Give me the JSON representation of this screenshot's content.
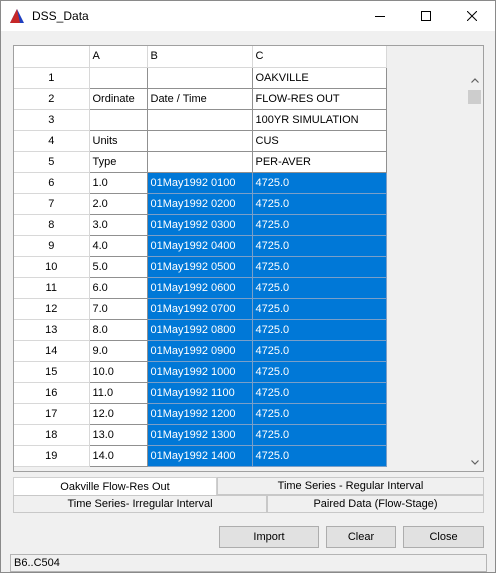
{
  "window": {
    "title": "DSS_Data"
  },
  "grid": {
    "columns": [
      "",
      "A",
      "B",
      "C"
    ],
    "rows": [
      {
        "num": "1",
        "a": "",
        "b": "",
        "c": "OAKVILLE",
        "sel": false
      },
      {
        "num": "2",
        "a": "Ordinate",
        "b": "Date / Time",
        "c": "FLOW-RES OUT",
        "sel": false
      },
      {
        "num": "3",
        "a": "",
        "b": "",
        "c": "100YR SIMULATION",
        "sel": false
      },
      {
        "num": "4",
        "a": "Units",
        "b": "",
        "c": "CUS",
        "sel": false
      },
      {
        "num": "5",
        "a": "Type",
        "b": "",
        "c": "PER-AVER",
        "sel": false
      },
      {
        "num": "6",
        "a": "1.0",
        "b": "01May1992 0100",
        "c": "4725.0",
        "sel": true
      },
      {
        "num": "7",
        "a": "2.0",
        "b": "01May1992 0200",
        "c": "4725.0",
        "sel": true
      },
      {
        "num": "8",
        "a": "3.0",
        "b": "01May1992 0300",
        "c": "4725.0",
        "sel": true
      },
      {
        "num": "9",
        "a": "4.0",
        "b": "01May1992 0400",
        "c": "4725.0",
        "sel": true
      },
      {
        "num": "10",
        "a": "5.0",
        "b": "01May1992 0500",
        "c": "4725.0",
        "sel": true
      },
      {
        "num": "11",
        "a": "6.0",
        "b": "01May1992 0600",
        "c": "4725.0",
        "sel": true
      },
      {
        "num": "12",
        "a": "7.0",
        "b": "01May1992 0700",
        "c": "4725.0",
        "sel": true
      },
      {
        "num": "13",
        "a": "8.0",
        "b": "01May1992 0800",
        "c": "4725.0",
        "sel": true
      },
      {
        "num": "14",
        "a": "9.0",
        "b": "01May1992 0900",
        "c": "4725.0",
        "sel": true
      },
      {
        "num": "15",
        "a": "10.0",
        "b": "01May1992 1000",
        "c": "4725.0",
        "sel": true
      },
      {
        "num": "16",
        "a": "11.0",
        "b": "01May1992 1100",
        "c": "4725.0",
        "sel": true
      },
      {
        "num": "17",
        "a": "12.0",
        "b": "01May1992 1200",
        "c": "4725.0",
        "sel": true
      },
      {
        "num": "18",
        "a": "13.0",
        "b": "01May1992 1300",
        "c": "4725.0",
        "sel": true
      },
      {
        "num": "19",
        "a": "14.0",
        "b": "01May1992 1400",
        "c": "4725.0",
        "sel": true
      }
    ]
  },
  "tabs": {
    "oakville": "Oakville Flow-Res Out",
    "regular": "Time Series - Regular Interval",
    "irregular": "Time Series- Irregular Interval",
    "paired": "Paired Data (Flow-Stage)"
  },
  "buttons": {
    "import": "Import",
    "clear": "Clear",
    "close": "Close"
  },
  "status": {
    "text": "B6..C504"
  },
  "colors": {
    "selection": "#0078d7",
    "icon_red": "#c62828",
    "icon_blue": "#1f3fbf"
  },
  "icons": {
    "app": "dss-triangle-icon",
    "minimize": "minimize-icon",
    "maximize": "maximize-icon",
    "close": "close-icon",
    "scroll_up": "chevron-up-icon",
    "scroll_down": "chevron-down-icon"
  }
}
